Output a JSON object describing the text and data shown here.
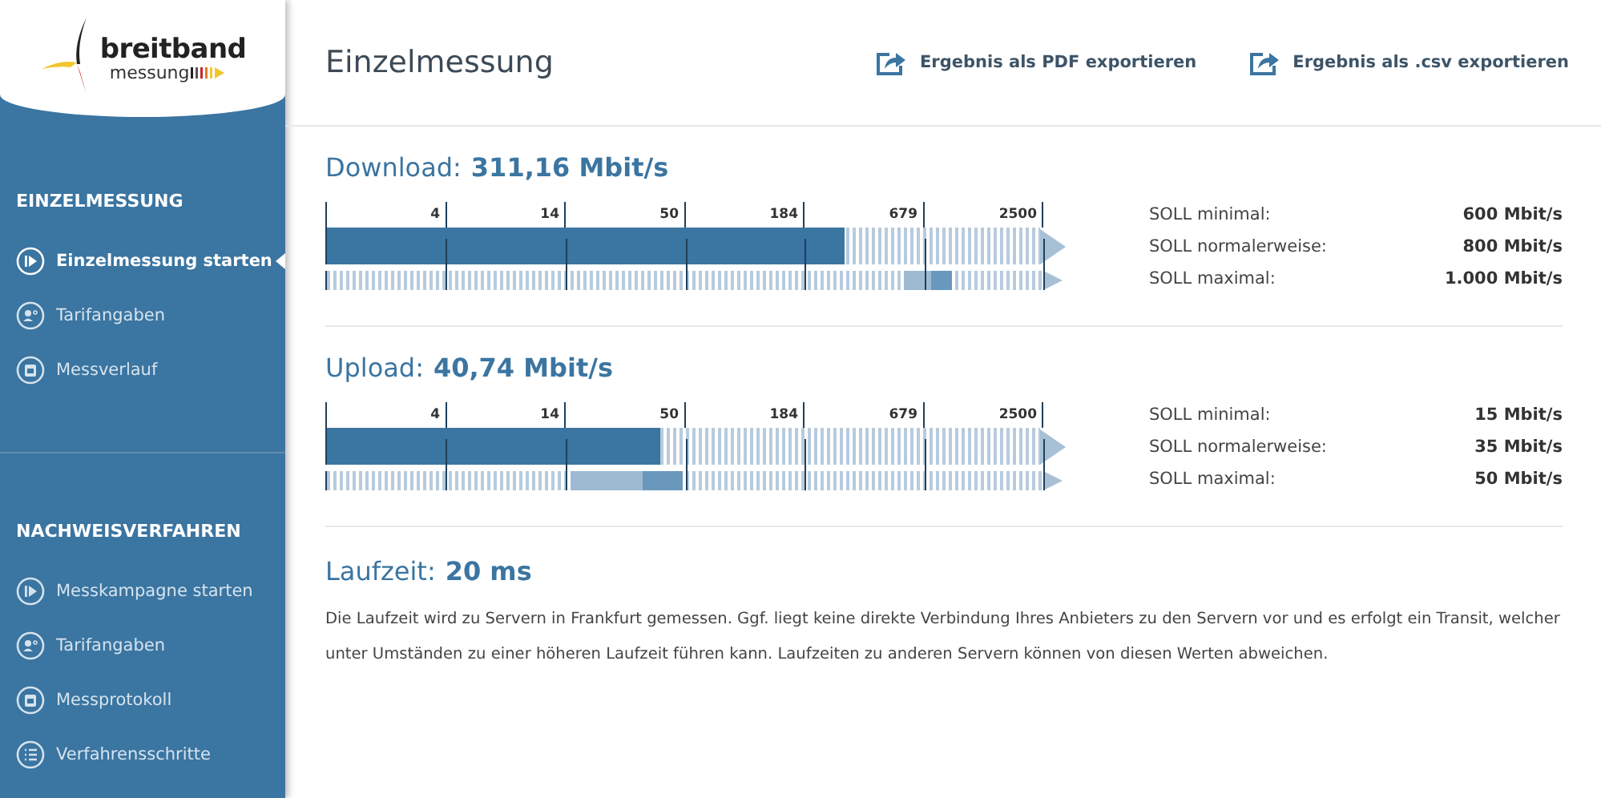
{
  "logo": {
    "line_1": "breitband",
    "line_2": "messung"
  },
  "sidebar": {
    "sections": [
      {
        "title": "EINZELMESSUNG",
        "items": [
          {
            "label": "Einzelmessung starten",
            "kind": "play",
            "selected": true
          },
          {
            "label": "Tarifangaben",
            "kind": "person",
            "selected": false
          },
          {
            "label": "Messverlauf",
            "kind": "calendar",
            "selected": false
          }
        ]
      },
      {
        "title": "NACHWEISVERFAHREN",
        "items": [
          {
            "label": "Messkampagne starten",
            "kind": "play",
            "selected": false
          },
          {
            "label": "Tarifangaben",
            "kind": "person",
            "selected": false
          },
          {
            "label": "Messprotokoll",
            "kind": "calendar",
            "selected": false
          },
          {
            "label": "Verfahrensschritte",
            "kind": "list",
            "selected": false
          }
        ]
      }
    ]
  },
  "header": {
    "title": "Einzelmessung",
    "actions": [
      "Ergebnis als PDF exportieren",
      "Ergebnis als .csv exportieren"
    ]
  },
  "results": [
    {
      "label": "Download:",
      "value": "311,16 Mbit/s",
      "scale": [
        "4",
        "14",
        "50",
        "184",
        "679",
        "2500"
      ],
      "level": 0.725,
      "target_band": [
        {
          "level": 0.805
        },
        {
          "level": 0.843
        },
        {
          "level": 0.872
        }
      ],
      "targets": [
        {
          "label": "SOLL minimal:",
          "value": "600 Mbit/s"
        },
        {
          "label": "SOLL normalerweise:",
          "value": "800 Mbit/s"
        },
        {
          "label": "SOLL maximal:",
          "value": "1.000 Mbit/s"
        }
      ]
    },
    {
      "label": "Upload:",
      "value": "40,74 Mbit/s",
      "scale": [
        "4",
        "14",
        "50",
        "184",
        "679",
        "2500"
      ],
      "level": 0.468,
      "target_band": [
        {
          "level": 0.34
        },
        {
          "level": 0.441
        },
        {
          "level": 0.497
        }
      ],
      "targets": [
        {
          "label": "SOLL minimal:",
          "value": "15 Mbit/s"
        },
        {
          "label": "SOLL normalerweise:",
          "value": "35 Mbit/s"
        },
        {
          "label": "SOLL maximal:",
          "value": "50 Mbit/s"
        }
      ]
    }
  ],
  "latency": {
    "label": "Laufzeit:",
    "value": "20 ms",
    "note": "Die Laufzeit wird zu Servern in Frankfurt gemessen. Ggf. liegt keine direkte Verbindung Ihres Anbieters zu den Servern vor und es erfolgt ein Transit, welcher unter Umständen zu einer höheren Laufzeit führen kann. Laufzeiten zu anderen Servern können von diesen Werten abweichen."
  }
}
